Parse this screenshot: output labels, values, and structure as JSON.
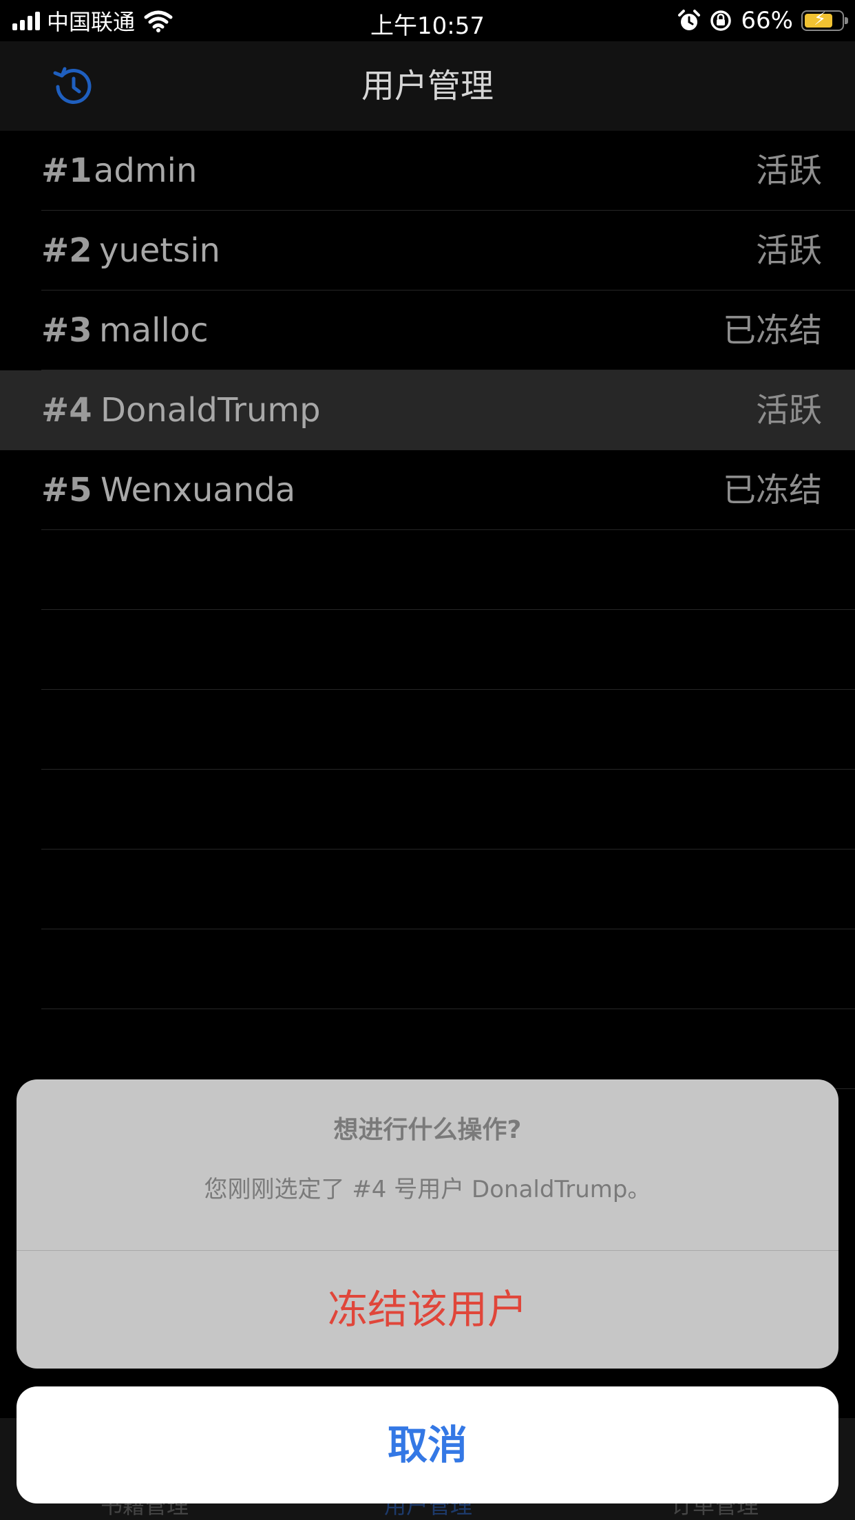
{
  "status_bar": {
    "carrier": "中国联通",
    "time": "上午10:57",
    "battery": "66%",
    "battery_level": 0.66
  },
  "nav": {
    "title": "用户管理",
    "left_icon": "history-icon"
  },
  "users": [
    {
      "id": "#1",
      "name": "admin",
      "status": "活跃",
      "selected": false
    },
    {
      "id": "#2",
      "name": "yuetsin",
      "status": "活跃",
      "selected": false
    },
    {
      "id": "#3",
      "name": "malloc",
      "status": "已冻结",
      "selected": false
    },
    {
      "id": "#4",
      "name": "DonaldTrump",
      "status": "活跃",
      "selected": true
    },
    {
      "id": "#5",
      "name": "Wenxuanda",
      "status": "已冻结",
      "selected": false
    }
  ],
  "tabs": [
    {
      "label": "书籍管理",
      "active": false
    },
    {
      "label": "用户管理",
      "active": true
    },
    {
      "label": "订单管理",
      "active": false
    }
  ],
  "action_sheet": {
    "title": "想进行什么操作?",
    "message": "您刚刚选定了 #4 号用户 DonaldTrump。",
    "action": "冻结该用户",
    "cancel": "取消"
  },
  "colors": {
    "accent": "#3478e5",
    "destructive": "#e0463a",
    "battery": "#f1c232"
  }
}
